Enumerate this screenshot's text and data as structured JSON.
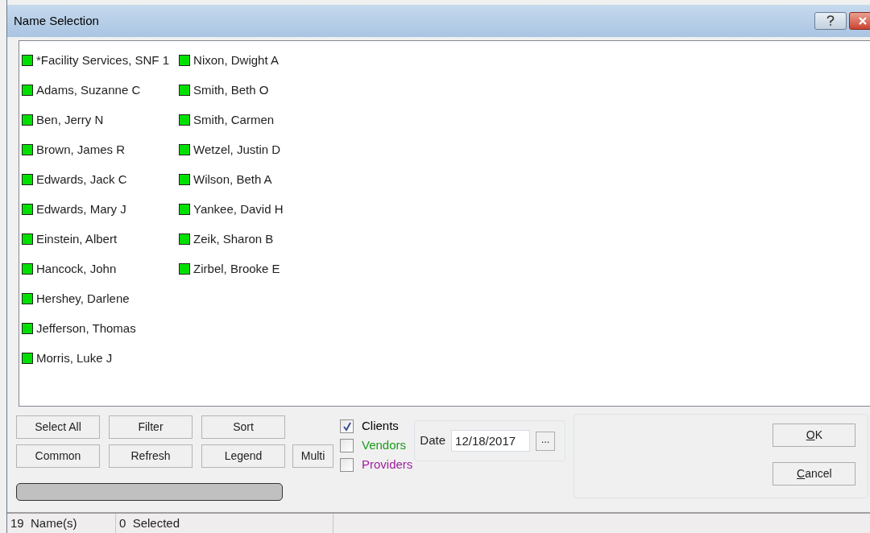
{
  "window": {
    "title": "Name Selection"
  },
  "names": [
    {
      "label": "*Facility Services, SNF 1",
      "color": "#00e000"
    },
    {
      "label": "Adams, Suzanne C",
      "color": "#00e000"
    },
    {
      "label": "Ben, Jerry N",
      "color": "#00e000"
    },
    {
      "label": "Brown, James R",
      "color": "#00e000"
    },
    {
      "label": "Edwards, Jack C",
      "color": "#00e000"
    },
    {
      "label": "Edwards, Mary J",
      "color": "#00e000"
    },
    {
      "label": "Einstein, Albert",
      "color": "#00e000"
    },
    {
      "label": "Hancock, John",
      "color": "#00e000"
    },
    {
      "label": "Hershey, Darlene",
      "color": "#00e000"
    },
    {
      "label": "Jefferson, Thomas",
      "color": "#00e000"
    },
    {
      "label": "Morris, Luke J",
      "color": "#00e000"
    },
    {
      "label": "Nixon, Dwight A",
      "color": "#00e000"
    },
    {
      "label": "Smith, Beth O",
      "color": "#00e000"
    },
    {
      "label": "Smith, Carmen",
      "color": "#00e000"
    },
    {
      "label": "Wetzel, Justin D",
      "color": "#00e000"
    },
    {
      "label": "Wilson, Beth A",
      "color": "#00e000"
    },
    {
      "label": "Yankee, David H",
      "color": "#00e000"
    },
    {
      "label": "Zeik, Sharon B",
      "color": "#00e000"
    },
    {
      "label": "Zirbel, Brooke E",
      "color": "#00e000"
    }
  ],
  "buttons": [
    [
      "Select All",
      "Filter",
      "Sort"
    ],
    [
      "Common",
      "Refresh",
      "Legend",
      "Multi"
    ]
  ],
  "filters": [
    {
      "label": "Clients",
      "checked": true,
      "color": "#000000"
    },
    {
      "label": "Vendors",
      "checked": false,
      "color": "#1a9a1a"
    },
    {
      "label": "Providers",
      "checked": false,
      "color": "#a020a0"
    }
  ],
  "date": {
    "label": "Date",
    "value": "12/18/2017",
    "picker": "..."
  },
  "dialog_buttons": [
    {
      "access_key": "O",
      "rest": "K"
    },
    {
      "access_key": "C",
      "rest": "ancel"
    }
  ],
  "status_bar": [
    "19  Name(s)",
    "0  Selected"
  ]
}
